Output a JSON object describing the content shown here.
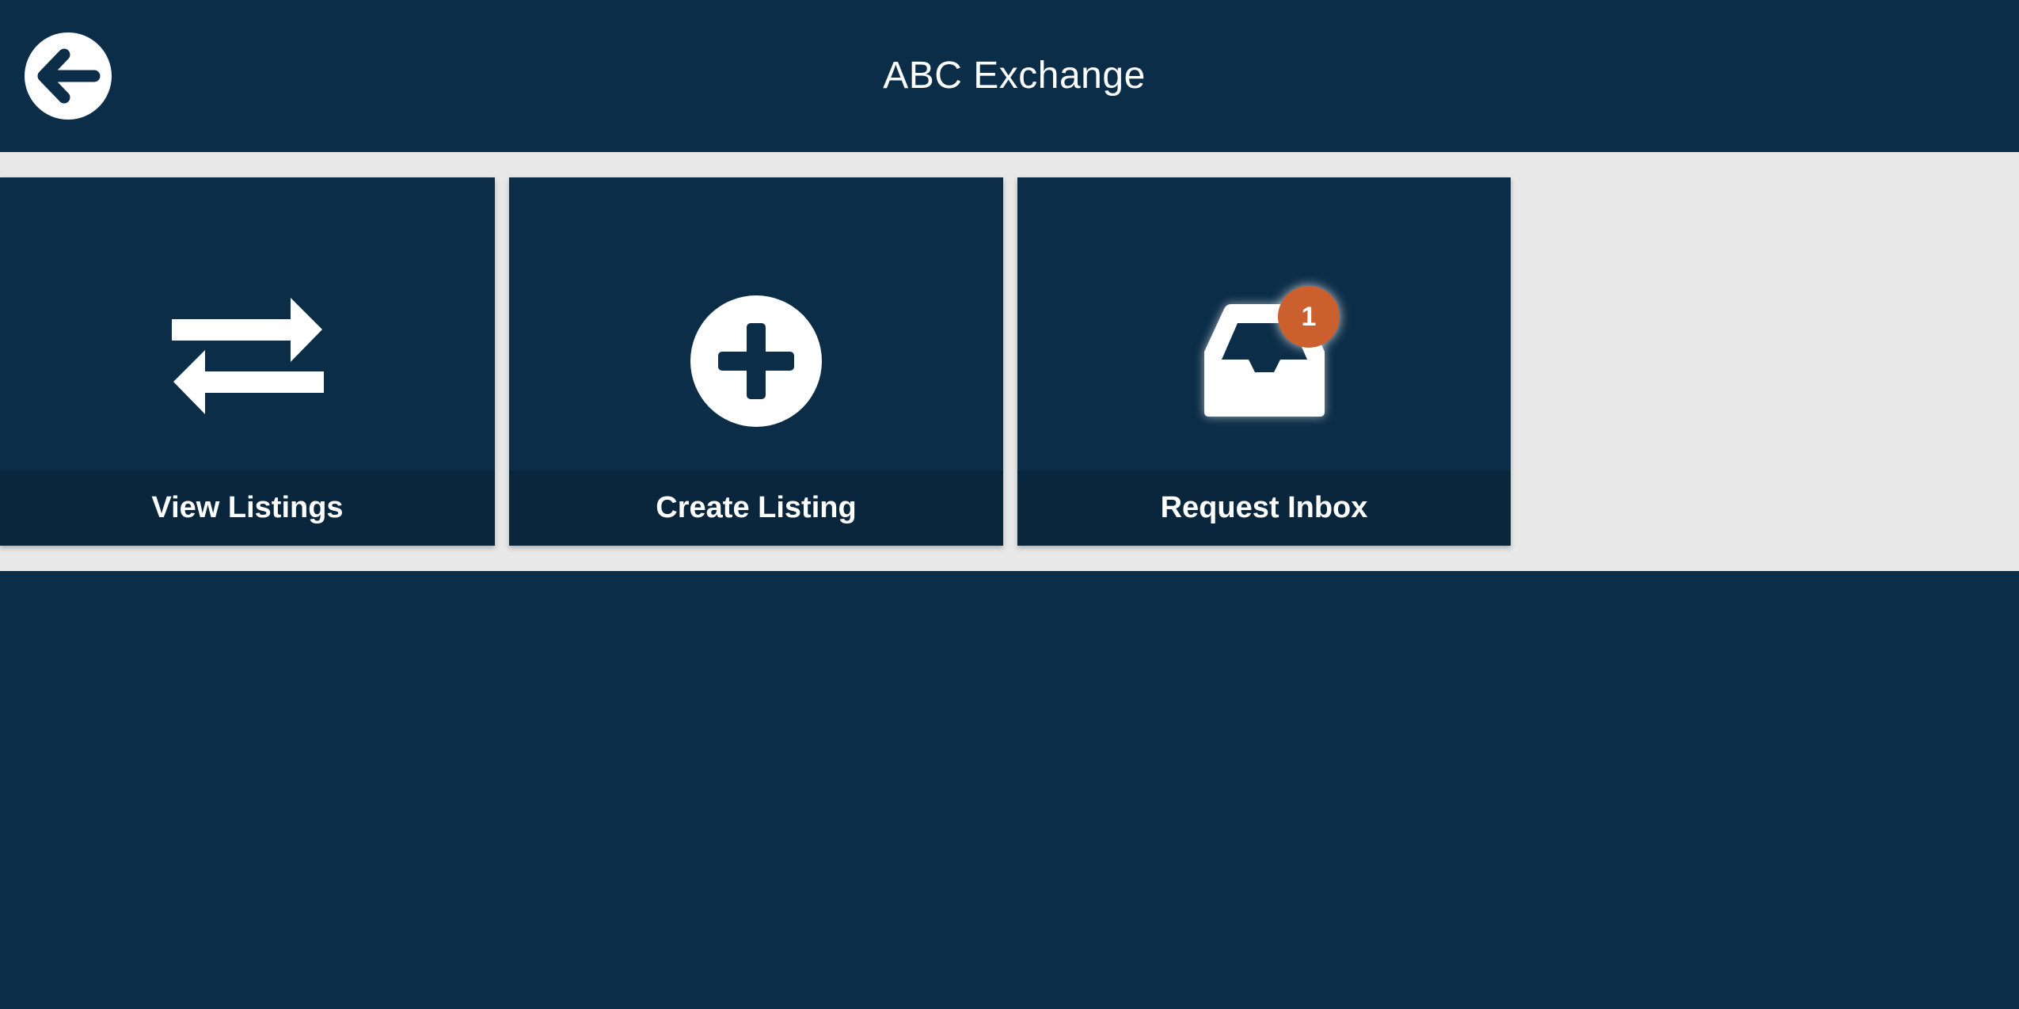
{
  "header": {
    "title": "ABC Exchange",
    "back_icon": "arrow-left-circle-icon"
  },
  "tiles": [
    {
      "label": "View Listings",
      "icon": "exchange-arrows-icon"
    },
    {
      "label": "Create Listing",
      "icon": "plus-circle-icon"
    },
    {
      "label": "Request Inbox",
      "icon": "inbox-tray-icon",
      "badge": "1"
    }
  ],
  "colors": {
    "primary": "#0c2d48",
    "label_bar": "#0a263d",
    "band": "#e8e8e8",
    "badge": "#cc5f2e",
    "icon": "#ffffff"
  }
}
